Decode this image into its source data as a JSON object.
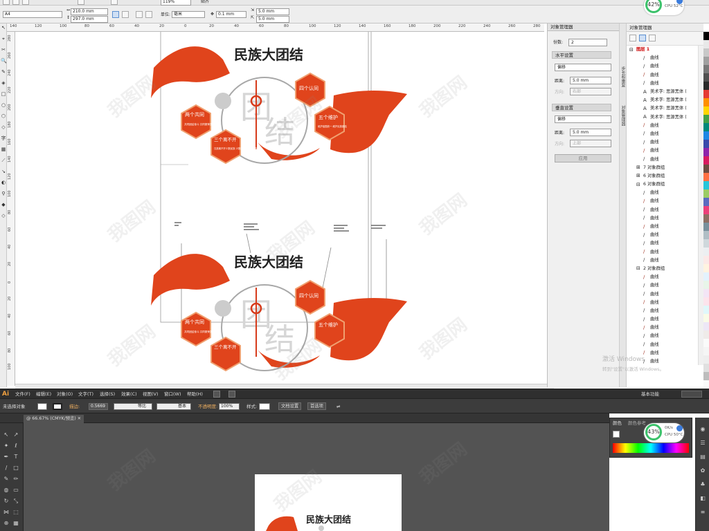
{
  "corel": {
    "toolbar": {
      "zoom": "119%",
      "snap_label": "贴齐"
    },
    "propbar": {
      "page_size": "A4",
      "width": "210.0 mm",
      "height": "297.0 mm",
      "unit_label": "单位:",
      "unit_value": "毫米",
      "nudge": "0.1 mm",
      "dup_x": "5.0 mm",
      "dup_y": "5.0 mm"
    },
    "ruler_h": [
      "140",
      "120",
      "100",
      "80",
      "60",
      "40",
      "20",
      "0",
      "20",
      "40",
      "60",
      "80",
      "100",
      "120",
      "140",
      "160",
      "180",
      "200",
      "220",
      "240",
      "260",
      "280"
    ],
    "ruler_v": [
      "280",
      "260",
      "240",
      "220",
      "200",
      "180",
      "160",
      "140",
      "120",
      "100",
      "80",
      "60",
      "40",
      "20",
      "0",
      "20",
      "40",
      "60",
      "80",
      "100"
    ],
    "design": {
      "title": "民族大团结",
      "big_char_1": "团",
      "big_char_2": "结",
      "hex_1": "两个共同",
      "hex_1_sub": "共同团结奋斗 共同繁荣发展",
      "hex_2": "三个离不开",
      "hex_2_sub": "汉族离不开少数民族 少数民族离不开汉族",
      "hex_3": "四个认同",
      "hex_4": "五个维护",
      "hex_4_sub": "维护祖国统一 维护民族团结"
    },
    "docker": {
      "title": "对象管理器",
      "copies_label": "份数:",
      "copies_value": "2",
      "horizontal_section": "水平设置",
      "h_mode": "偏移",
      "h_dist_label": "距离:",
      "h_dist_value": "5.0 mm",
      "h_dir_label": "方向:",
      "h_dir_value": "右部",
      "vertical_section": "垂直设置",
      "v_mode": "偏移",
      "v_dist_label": "距离:",
      "v_dist_value": "5.0 mm",
      "v_dir_label": "方向:",
      "v_dir_value": "上部",
      "apply": "应用"
    },
    "vertical_tabs": [
      "步长和重复",
      "对象管理器"
    ],
    "object_manager": {
      "header": "对象管理器",
      "rows": [
        {
          "indent": 0,
          "icon": "⊟",
          "text": "图层 1",
          "color": "#cc0000",
          "bold": true
        },
        {
          "indent": 2,
          "icon": "∕",
          "text": "曲线"
        },
        {
          "indent": 2,
          "icon": "∕",
          "text": "曲线"
        },
        {
          "indent": 2,
          "icon": "∕",
          "text": "曲线"
        },
        {
          "indent": 2,
          "icon": "∕",
          "text": "曲线"
        },
        {
          "indent": 2,
          "icon": "A",
          "text": "美术字: 思源黑体 ("
        },
        {
          "indent": 2,
          "icon": "A",
          "text": "美术字: 思源黑体 ("
        },
        {
          "indent": 2,
          "icon": "A",
          "text": "美术字: 思源黑体 ("
        },
        {
          "indent": 2,
          "icon": "A",
          "text": "美术字: 思源黑体 ("
        },
        {
          "indent": 2,
          "icon": "∕",
          "text": "曲线"
        },
        {
          "indent": 2,
          "icon": "∕",
          "text": "曲线"
        },
        {
          "indent": 2,
          "icon": "∕",
          "text": "曲线"
        },
        {
          "indent": 2,
          "icon": "∕",
          "text": "曲线"
        },
        {
          "indent": 2,
          "icon": "∕",
          "text": "曲线"
        },
        {
          "indent": 1,
          "icon": "⊞",
          "text": "7 对象群组"
        },
        {
          "indent": 1,
          "icon": "⊞",
          "text": "6 对象群组"
        },
        {
          "indent": 1,
          "icon": "⊟",
          "text": "6 对象群组"
        },
        {
          "indent": 2,
          "icon": "∕",
          "text": "曲线"
        },
        {
          "indent": 2,
          "icon": "∕",
          "text": "曲线"
        },
        {
          "indent": 2,
          "icon": "∕",
          "text": "曲线"
        },
        {
          "indent": 2,
          "icon": "∕",
          "text": "曲线"
        },
        {
          "indent": 2,
          "icon": "∕",
          "text": "曲线"
        },
        {
          "indent": 2,
          "icon": "∕",
          "text": "曲线"
        },
        {
          "indent": 2,
          "icon": "∕",
          "text": "曲线"
        },
        {
          "indent": 2,
          "icon": "∕",
          "text": "曲线"
        },
        {
          "indent": 2,
          "icon": "∕",
          "text": "曲线"
        },
        {
          "indent": 1,
          "icon": "⊟",
          "text": "2 对象群组"
        },
        {
          "indent": 2,
          "icon": "∕",
          "text": "曲线"
        },
        {
          "indent": 2,
          "icon": "∕",
          "text": "曲线"
        },
        {
          "indent": 2,
          "icon": "∕",
          "text": "曲线"
        },
        {
          "indent": 2,
          "icon": "∕",
          "text": "曲线"
        },
        {
          "indent": 2,
          "icon": "∕",
          "text": "曲线"
        },
        {
          "indent": 2,
          "icon": "∕",
          "text": "曲线"
        },
        {
          "indent": 2,
          "icon": "∕",
          "text": "曲线"
        },
        {
          "indent": 2,
          "icon": "∕",
          "text": "曲线"
        },
        {
          "indent": 2,
          "icon": "∕",
          "text": "曲线"
        },
        {
          "indent": 2,
          "icon": "∕",
          "text": "曲线"
        },
        {
          "indent": 2,
          "icon": "∕",
          "text": "曲线"
        },
        {
          "indent": 2,
          "icon": "∕",
          "text": "曲线"
        }
      ]
    },
    "palette": [
      "#ffffff",
      "#000000",
      "#e8e8e8",
      "#c8c8c8",
      "#a0a0a0",
      "#787878",
      "#505050",
      "#2a2a2a",
      "#e53935",
      "#ff8f00",
      "#ffd600",
      "#43a047",
      "#00897b",
      "#1e88e5",
      "#3949ab",
      "#8e24aa",
      "#d81b60",
      "#6d4c41",
      "#ff7043",
      "#26c6da",
      "#9ccc65",
      "#5c6bc0",
      "#ec407a",
      "#8d6e63",
      "#78909c",
      "#b0bec5",
      "#cfd8dc",
      "#eceff1",
      "#fbe9e7",
      "#fff3e0",
      "#e3f2fd",
      "#e8f5e9",
      "#f3e5f5",
      "#fce4ec",
      "#e0f7fa",
      "#f9fbe7",
      "#ede7f6",
      "#efebe9",
      "#fafafa",
      "#f5f5f5",
      "#eeeeee",
      "#e0e0e0",
      "#bdbdbd"
    ],
    "cpu": {
      "percent": "42%",
      "line1": "",
      "line2": "CPU 52°C"
    }
  },
  "windows_activation": {
    "line1": "激活 Windows",
    "line2": "转到\"设置\"以激活 Windows。"
  },
  "illustrator": {
    "logo": "Ai",
    "menus": [
      "文件(F)",
      "编辑(E)",
      "对象(O)",
      "文字(T)",
      "选择(S)",
      "效果(C)",
      "视图(V)",
      "窗口(W)",
      "帮助(H)"
    ],
    "workspace": "基本功能",
    "control": {
      "selection": "未选择对象",
      "stroke_label": "描边:",
      "stroke_value": "0.5669",
      "stroke_profile": "等比",
      "brush": "基本",
      "opacity_label": "不透明度:",
      "opacity_value": "100%",
      "style_label": "样式:",
      "doc_setup": "文档设置",
      "prefs": "首选项"
    },
    "doc_tab": "@ 66.67% (CMYK/预览)",
    "color_panel": {
      "tab1": "颜色",
      "tab2": "颜色参考"
    },
    "artboard_title": "民族大团结",
    "cpu": {
      "percent": "43%",
      "line1": "0K/s",
      "line2": "CPU 50°C"
    }
  },
  "watermark": "我图网"
}
